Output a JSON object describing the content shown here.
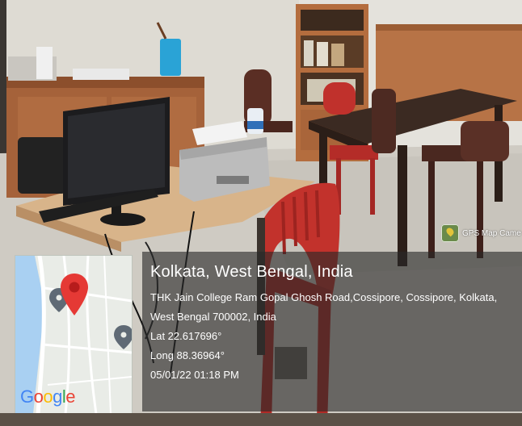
{
  "app": {
    "watermark": "GPS Map Came"
  },
  "location": {
    "place": "Kolkata, West Bengal, India",
    "address_line1": "THK Jain College Ram Gopal Ghosh Road,Cossipore, Cossipore, Kolkata,",
    "address_line2": "West Bengal 700002, India",
    "lat": "Lat 22.617696°",
    "long": "Long 88.36964°",
    "datetime": "05/01/22 01:18 PM"
  },
  "map": {
    "logo": "Google",
    "pin_color": "#e53935"
  }
}
